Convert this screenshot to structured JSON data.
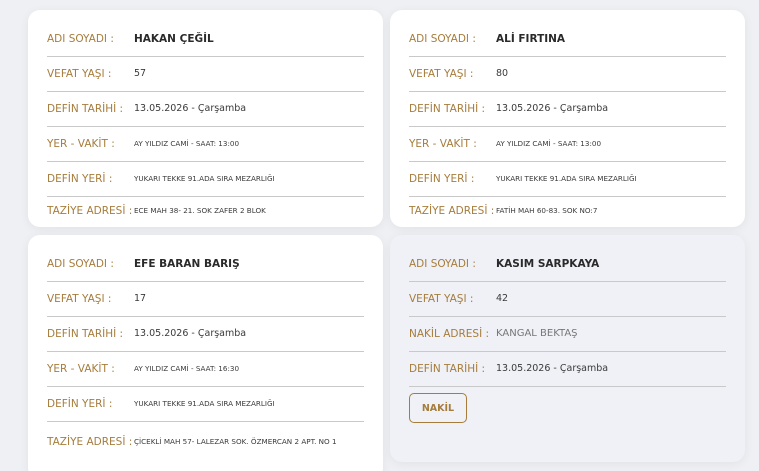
{
  "labels": {
    "name": "ADI SOYADI :",
    "age": "VEFAT YAŞI :",
    "date": "DEFİN TARİHİ :",
    "place_time": "YER - VAKİT :",
    "burial": "DEFİN YERİ :",
    "condolence": "TAZİYE ADRESİ :",
    "nakil_address": "NAKİL ADRESİ :"
  },
  "cards": [
    {
      "name": "HAKAN ÇEĞİL",
      "age": "57",
      "date": "13.05.2026 - Çarşamba",
      "place_time": "AY YILDIZ CAMİ - SAAT: 13:00",
      "burial": "YUKARI TEKKE 91.ADA SIRA MEZARLIĞI",
      "condolence": "ECE MAH 38- 21. SOK ZAFER 2 BLOK"
    },
    {
      "name": "ALİ FIRTINA",
      "age": "80",
      "date": "13.05.2026 - Çarşamba",
      "place_time": "AY YILDIZ CAMİ - SAAT: 13:00",
      "burial": "YUKARI TEKKE 91.ADA SIRA MEZARLIĞI",
      "condolence": "FATİH MAH 60-83. SOK NO:7"
    },
    {
      "name": "EFE BARAN BARIŞ",
      "age": "17",
      "date": "13.05.2026 - Çarşamba",
      "place_time": "AY YILDIZ CAMİ - SAAT: 16:30",
      "burial": "YUKARI TEKKE 91.ADA SIRA MEZARLIĞI",
      "condolence": "ÇİCEKLİ MAH 57- LALEZAR SOK. ÖZMERCAN 2 APT. NO 1"
    },
    {
      "name": "KASIM SARPKAYA",
      "age": "42",
      "nakil_address": "KANGAL BEKTAŞ",
      "date": "13.05.2026 - Çarşamba",
      "button_label": "NAKİL"
    }
  ]
}
